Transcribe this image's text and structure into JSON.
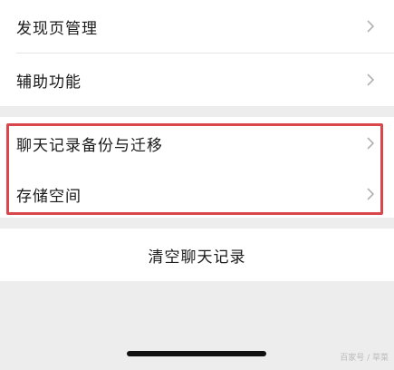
{
  "settings": {
    "group_top": [
      {
        "label": "发现页管理"
      },
      {
        "label": "辅助功能"
      }
    ],
    "group_mid": [
      {
        "label": "聊天记录备份与迁移"
      },
      {
        "label": "存储空间"
      }
    ],
    "clear_history_label": "清空聊天记录"
  },
  "watermark": "百家号 / 草菜",
  "colors": {
    "highlight": "#d9474b",
    "background": "#ededed",
    "card": "#ffffff",
    "chevron": "#b2b2b2"
  }
}
